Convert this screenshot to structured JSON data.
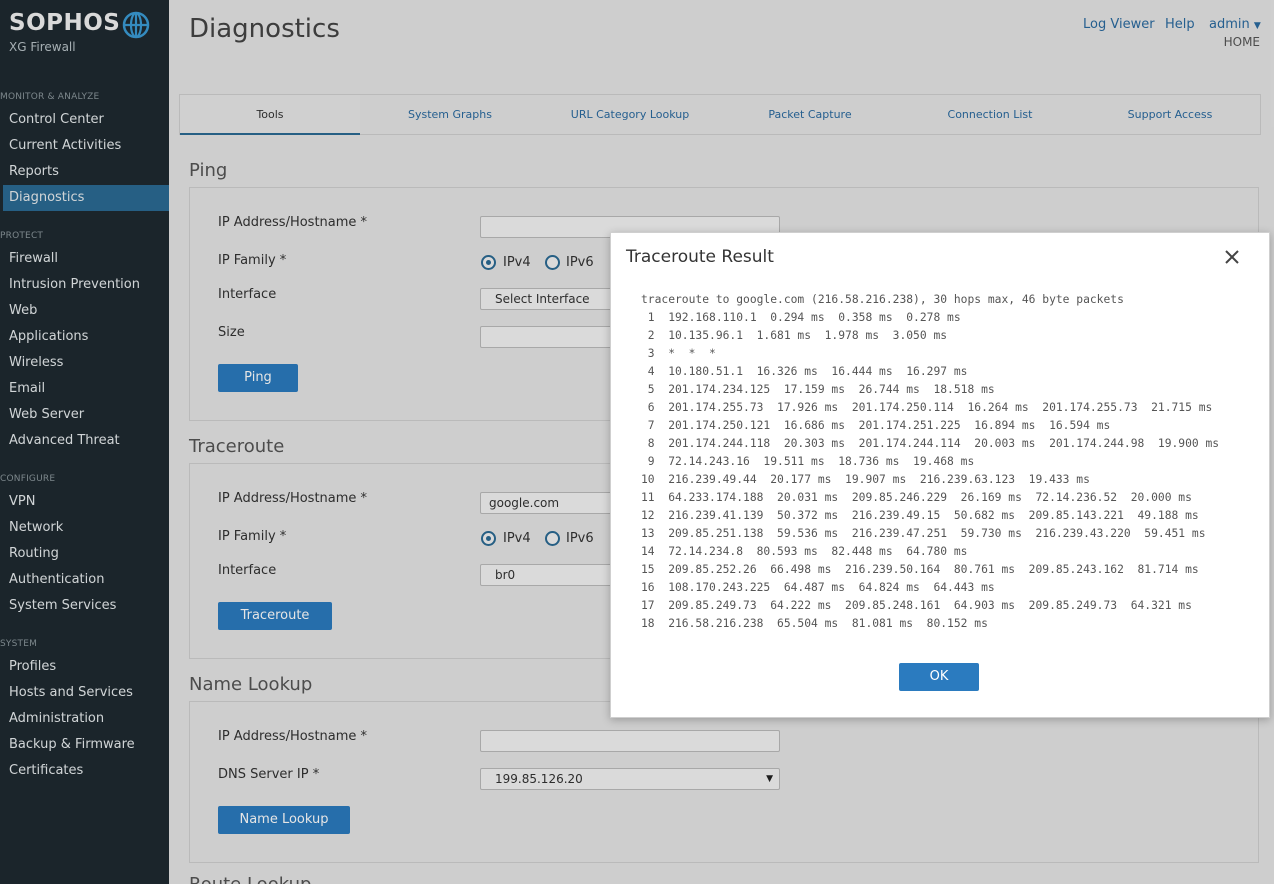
{
  "brand": {
    "name": "SOPHOS",
    "product": "XG Firewall"
  },
  "sidebar": {
    "sections": [
      {
        "label": "MONITOR & ANALYZE",
        "items": [
          "Control Center",
          "Current Activities",
          "Reports",
          "Diagnostics"
        ]
      },
      {
        "label": "PROTECT",
        "items": [
          "Firewall",
          "Intrusion Prevention",
          "Web",
          "Applications",
          "Wireless",
          "Email",
          "Web Server",
          "Advanced Threat"
        ]
      },
      {
        "label": "CONFIGURE",
        "items": [
          "VPN",
          "Network",
          "Routing",
          "Authentication",
          "System Services"
        ]
      },
      {
        "label": "SYSTEM",
        "items": [
          "Profiles",
          "Hosts and Services",
          "Administration",
          "Backup & Firmware",
          "Certificates"
        ]
      }
    ],
    "active_item": "Diagnostics"
  },
  "header": {
    "title": "Diagnostics",
    "links": {
      "log_viewer": "Log Viewer",
      "help": "Help",
      "user": "admin",
      "home": "HOME"
    }
  },
  "tabs": [
    "Tools",
    "System Graphs",
    "URL Category Lookup",
    "Packet Capture",
    "Connection List",
    "Support Access"
  ],
  "ping": {
    "title": "Ping",
    "host_label": "IP Address/Hostname *",
    "host_value": "",
    "family_label": "IP Family *",
    "ipv4": "IPv4",
    "ipv6": "IPv6",
    "interface_label": "Interface",
    "interface_value": "Select Interface",
    "size_label": "Size",
    "size_value": "",
    "button": "Ping"
  },
  "traceroute": {
    "title": "Traceroute",
    "host_label": "IP Address/Hostname *",
    "host_value": "google.com",
    "family_label": "IP Family *",
    "ipv4": "IPv4",
    "ipv6": "IPv6",
    "interface_label": "Interface",
    "interface_value": "br0",
    "button": "Traceroute"
  },
  "name_lookup": {
    "title": "Name Lookup",
    "host_label": "IP Address/Hostname *",
    "host_value": "",
    "dns_label": "DNS Server IP *",
    "dns_value": "199.85.126.20",
    "button": "Name Lookup"
  },
  "next_section_title": "Route Lookup",
  "modal": {
    "title": "Traceroute Result",
    "ok": "OK",
    "lines": [
      "traceroute to google.com (216.58.216.238), 30 hops max, 46 byte packets",
      " 1  192.168.110.1  0.294 ms  0.358 ms  0.278 ms",
      " 2  10.135.96.1  1.681 ms  1.978 ms  3.050 ms",
      " 3  *  *  *",
      " 4  10.180.51.1  16.326 ms  16.444 ms  16.297 ms",
      " 5  201.174.234.125  17.159 ms  26.744 ms  18.518 ms",
      " 6  201.174.255.73  17.926 ms  201.174.250.114  16.264 ms  201.174.255.73  21.715 ms",
      " 7  201.174.250.121  16.686 ms  201.174.251.225  16.894 ms  16.594 ms",
      " 8  201.174.244.118  20.303 ms  201.174.244.114  20.003 ms  201.174.244.98  19.900 ms",
      " 9  72.14.243.16  19.511 ms  18.736 ms  19.468 ms",
      "10  216.239.49.44  20.177 ms  19.907 ms  216.239.63.123  19.433 ms",
      "11  64.233.174.188  20.031 ms  209.85.246.229  26.169 ms  72.14.236.52  20.000 ms",
      "12  216.239.41.139  50.372 ms  216.239.49.15  50.682 ms  209.85.143.221  49.188 ms",
      "13  209.85.251.138  59.536 ms  216.239.47.251  59.730 ms  216.239.43.220  59.451 ms",
      "14  72.14.234.8  80.593 ms  82.448 ms  64.780 ms",
      "15  209.85.252.26  66.498 ms  216.239.50.164  80.761 ms  209.85.243.162  81.714 ms",
      "16  108.170.243.225  64.487 ms  64.824 ms  64.443 ms",
      "17  209.85.249.73  64.222 ms  209.85.248.161  64.903 ms  209.85.249.73  64.321 ms",
      "18  216.58.216.238  65.504 ms  81.081 ms  80.152 ms"
    ]
  },
  "colors": {
    "sidebar_bg": "#1f2a30",
    "accent": "#2b7bbf",
    "active_nav": "#2b6a94",
    "link": "#2a6aa0"
  },
  "icons": {
    "logo": "sophos-globe-icon",
    "close": "close-icon",
    "dropdown": "chevron-down-icon"
  }
}
